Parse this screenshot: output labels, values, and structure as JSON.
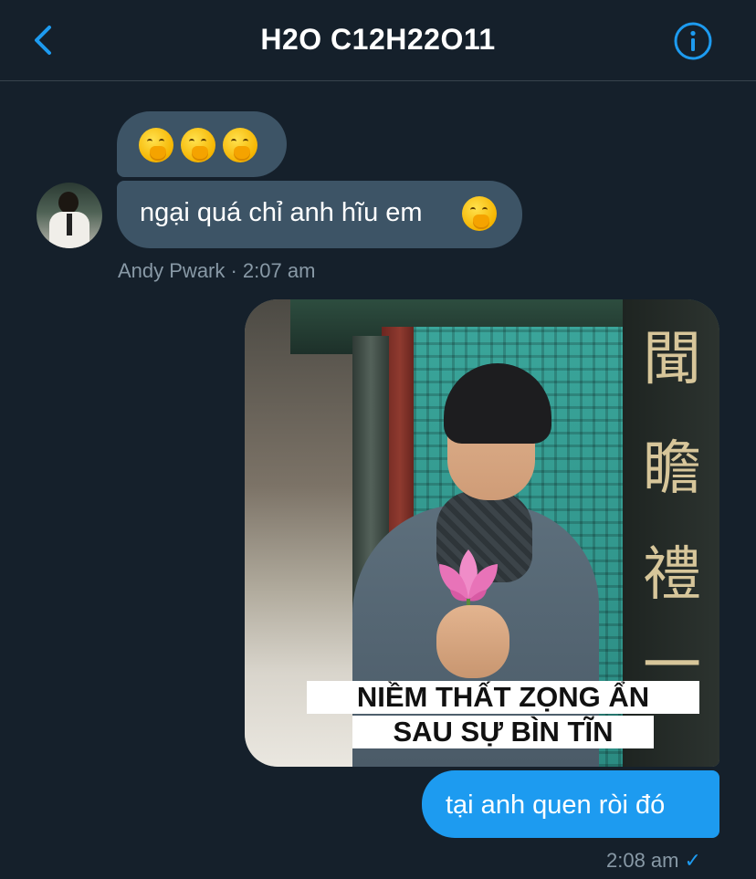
{
  "header": {
    "title": "H2O C12H22O11",
    "back_icon": "chevron-left-icon",
    "info_icon": "info-icon",
    "accent_color": "#1d9bf0"
  },
  "messages": {
    "incoming": {
      "emoji_row": [
        "face-with-hand-over-mouth",
        "face-with-hand-over-mouth",
        "face-with-hand-over-mouth"
      ],
      "text": "ngại quá chỉ anh hĩu em",
      "trailing_emoji": "face-with-hand-over-mouth",
      "sender": "Andy Pwark",
      "time": "2:07 am",
      "meta": "Andy Pwark · 2:07 am"
    },
    "outgoing": {
      "image": {
        "caption_line1": "NIỀM THẤT ZỌNG ẨN",
        "caption_line2": "SAU SỰ BÌN TĨN",
        "hanzi": [
          "聞",
          "瞻",
          "禮",
          "一"
        ]
      },
      "text": "tại anh quen ròi đó",
      "time": "2:08 am",
      "status_icon": "check-icon"
    }
  },
  "colors": {
    "background": "#15202b",
    "incoming_bubble": "#3d5466",
    "outgoing_bubble": "#1d9bf0",
    "meta_text": "#8899a6"
  }
}
